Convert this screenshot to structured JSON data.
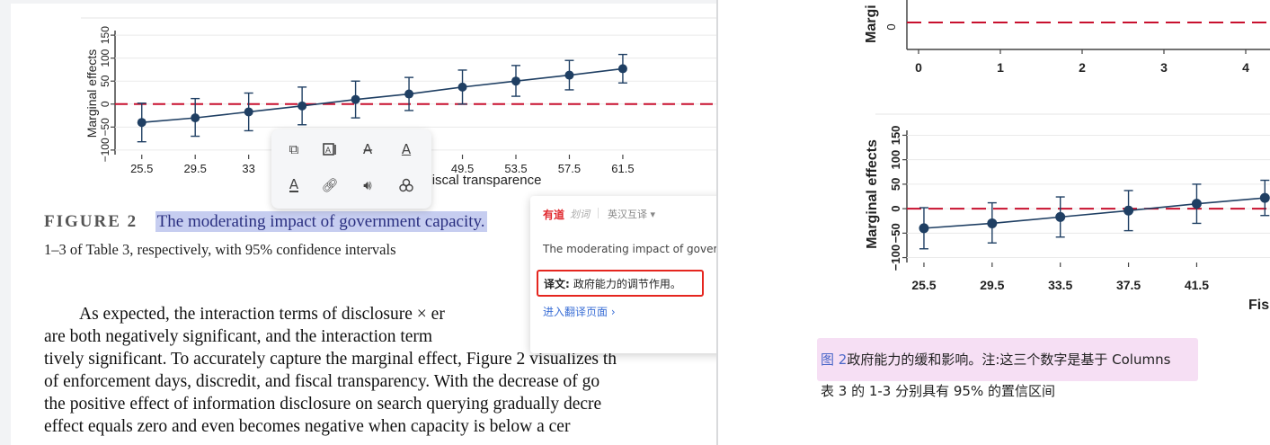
{
  "left_chart": {
    "ylabel": "Marginal effects",
    "yticks": [
      "−100",
      "−50",
      "0",
      "50",
      "100",
      "150"
    ],
    "xticks": [
      "25.5",
      "29.5",
      "33",
      "45.5",
      "49.5",
      "53.5",
      "57.5",
      "61.5"
    ],
    "xlabel": "Fiscal transparence",
    "points_x": [
      25.5,
      29.5,
      33.5,
      37.5,
      41.5,
      45.5,
      49.5,
      53.5,
      57.5,
      61.5
    ],
    "points_y": [
      -40,
      -30,
      -17,
      -4,
      10,
      22,
      37,
      50,
      63,
      77
    ],
    "ci_low": [
      -82,
      -70,
      -58,
      -45,
      -30,
      -14,
      0,
      17,
      31,
      46
    ],
    "ci_high": [
      2,
      12,
      24,
      37,
      50,
      58,
      74,
      84,
      95,
      108
    ]
  },
  "caption": {
    "label": "FIGURE 2",
    "title": "The moderating impact of government capacity.",
    "subline": "1–3 of Table 3, respectively, with 95% confidence intervals"
  },
  "paragraph": [
    "As expected, the interaction terms of disclosure × er",
    "are both negatively significant, and the interaction term",
    "tively significant. To accurately capture the marginal effect, Figure 2 visualizes th",
    "of enforcement days, discredit, and fiscal transparency. With the decrease of go",
    "the positive effect of information disclosure on search querying gradually decre",
    "effect equals zero and even becomes negative when capacity is below a cer"
  ],
  "toolbar": {
    "icons": [
      "copy-icon",
      "translate-box-icon",
      "strikethrough-icon",
      "underline-icon",
      "highlight-icon",
      "link-icon",
      "speaker-icon",
      "ai-icon"
    ]
  },
  "youdao_popup": {
    "brand": "有道",
    "brand_sub": "划词",
    "mode": "英汉互译 ▾",
    "original": "The moderating impact of govern",
    "translation_label": "译文:",
    "translation": "政府能力的调节作用。",
    "link": "进入翻译页面 ›"
  },
  "right_top_chart": {
    "ylabel_partial": "Margi",
    "ytick": "0",
    "xticks": [
      "0",
      "1",
      "2",
      "3",
      "4"
    ]
  },
  "right_chart": {
    "ylabel": "Marginal effects",
    "yticks": [
      "−100",
      "−50",
      "0",
      "50",
      "100",
      "150"
    ],
    "xticks": [
      "25.5",
      "29.5",
      "33.5",
      "37.5",
      "41.5"
    ],
    "xlabel_partial": "Fis"
  },
  "chinese_caption": {
    "label": "图 2",
    "line1": "政府能力的缓和影响。注:这三个数字是基于 Columns",
    "line2": "表 3 的 1-3 分别具有 95% 的置信区间"
  },
  "colors": {
    "accent_red": "#c8102e",
    "series_blue": "#1f3f63",
    "highlight": "#c6cdf0",
    "popup_border": "#e5261f"
  }
}
